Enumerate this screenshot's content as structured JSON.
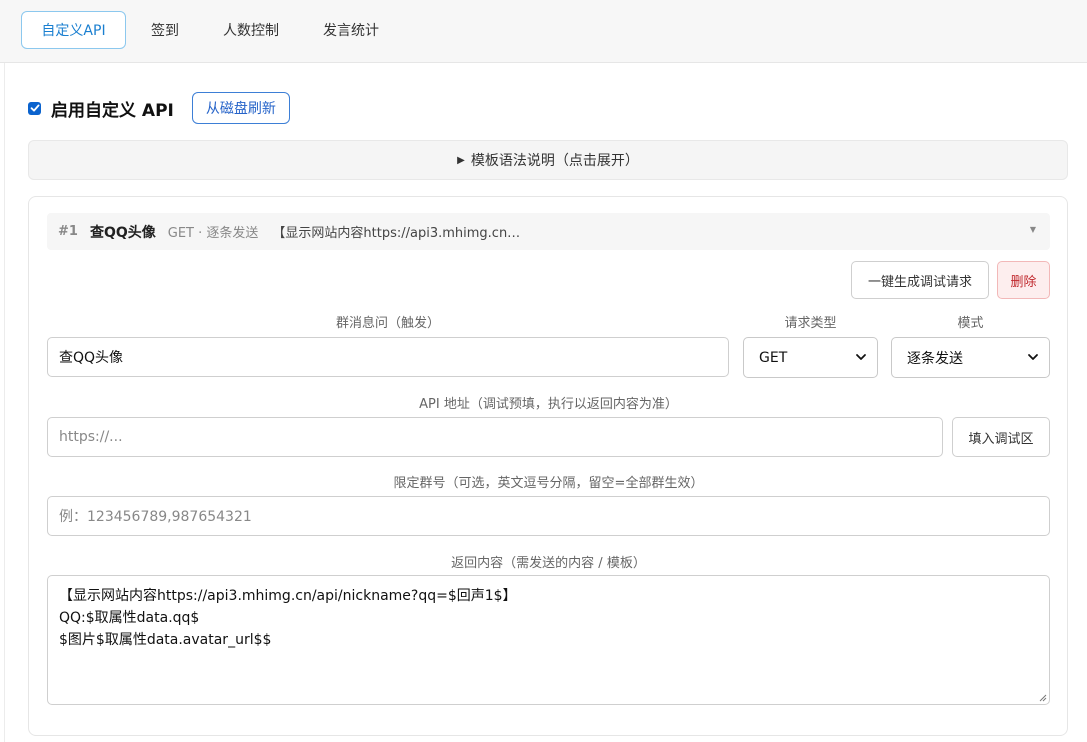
{
  "tabs": [
    {
      "label": "自定义API",
      "active": true
    },
    {
      "label": "签到",
      "active": false
    },
    {
      "label": "人数控制",
      "active": false
    },
    {
      "label": "发言统计",
      "active": false
    }
  ],
  "enable": {
    "label": "启用自定义 API",
    "checked": true,
    "refresh_button": "从磁盘刷新"
  },
  "syntax_help": {
    "label": "模板语法说明（点击展开）"
  },
  "entry": {
    "number": "#1",
    "name": "查QQ头像",
    "meta": "GET · 逐条发送",
    "preview": "【显示网站内容https://api3.mhimg.cn…",
    "buttons": {
      "generate_debug": "一键生成调试请求",
      "delete": "删除"
    },
    "trigger": {
      "label": "群消息问（触发）",
      "value": "查QQ头像"
    },
    "request_type": {
      "label": "请求类型",
      "value": "GET"
    },
    "mode": {
      "label": "模式",
      "value": "逐条发送"
    },
    "api_url": {
      "label": "API 地址（调试预填，执行以返回内容为准）",
      "placeholder": "https://...",
      "fill_button": "填入调试区"
    },
    "groups": {
      "label": "限定群号（可选，英文逗号分隔，留空=全部群生效）",
      "placeholder": "例：123456789,987654321"
    },
    "response": {
      "label": "返回内容（需发送的内容 / 模板）",
      "lines": [
        "【显示网站内容https://api3.mhimg.cn/api/nickname?qq=$回声1$】",
        "QQ:$取属性data.qq$",
        "$图片$取属性data.avatar_url$$"
      ]
    }
  },
  "colors": {
    "accent": "#2563c9",
    "checkbox": "#0b63ce",
    "danger": "#c0282d",
    "danger_bg": "#fdeeee"
  }
}
